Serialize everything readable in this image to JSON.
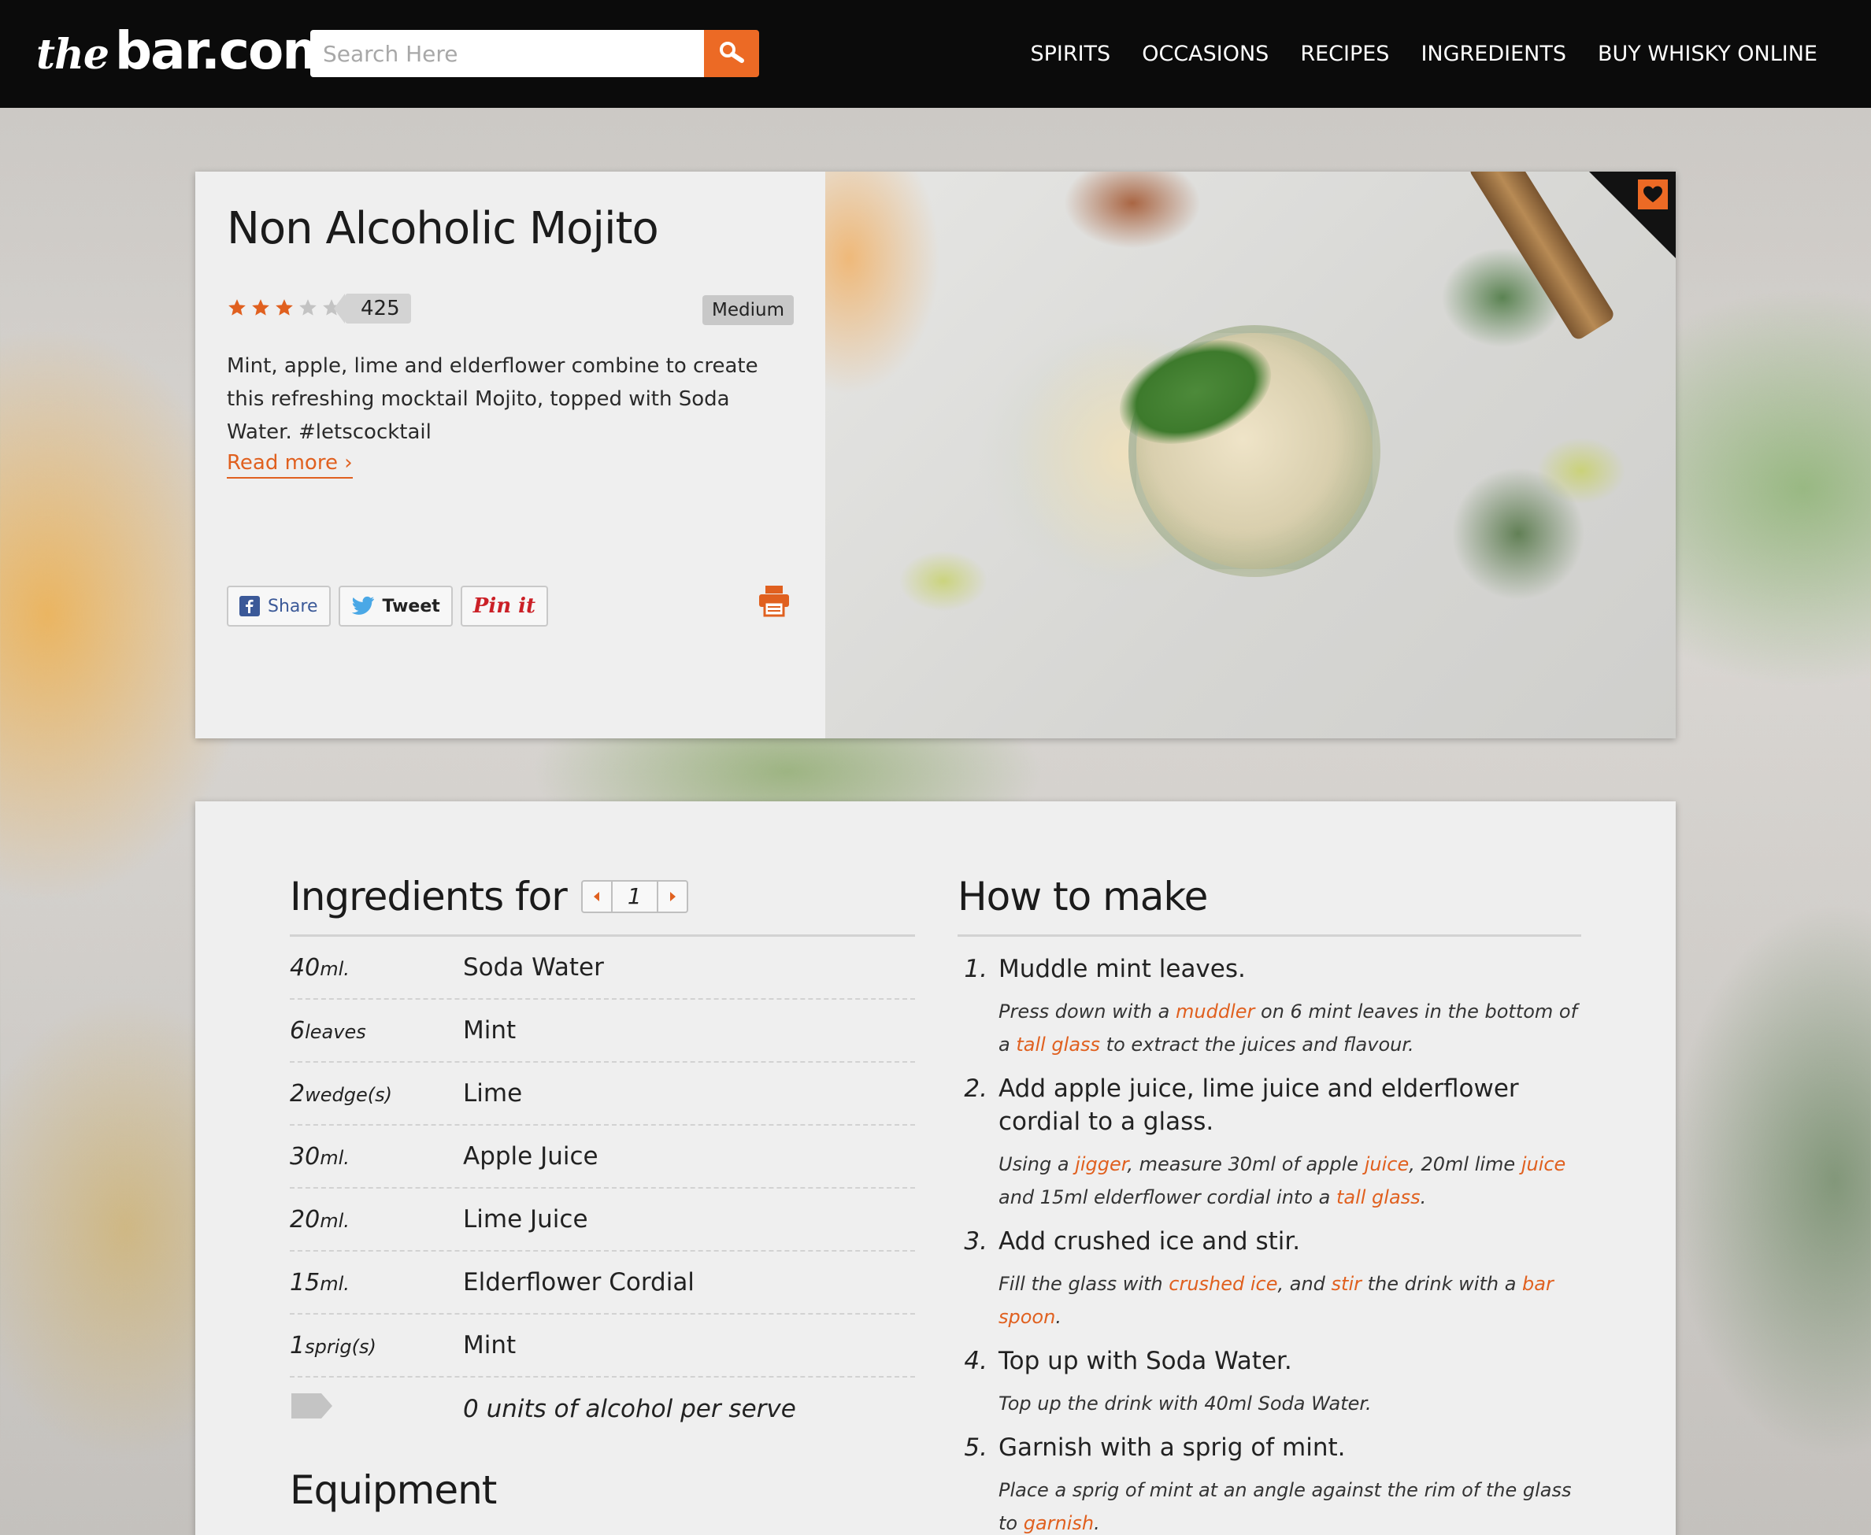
{
  "header": {
    "logo": {
      "the": "the",
      "bar": "bar.com",
      "reg": "®"
    },
    "search": {
      "placeholder": "Search Here",
      "button_icon": "search-icon"
    },
    "nav": [
      {
        "label": "SPIRITS"
      },
      {
        "label": "OCCASIONS"
      },
      {
        "label": "RECIPES"
      },
      {
        "label": "INGREDIENTS"
      },
      {
        "label": "BUY WHISKY ONLINE"
      }
    ]
  },
  "recipe": {
    "title": "Non Alcoholic Mojito",
    "rating": {
      "stars_filled": 3,
      "stars_total": 5,
      "count": "425"
    },
    "difficulty": "Medium",
    "description": "Mint, apple, lime and elderflower combine to create this refreshing mocktail Mojito, topped with Soda Water. #letscocktail",
    "read_more": "Read more ›",
    "share": {
      "facebook": "Share",
      "twitter": "Tweet",
      "pinterest": "Pin it"
    },
    "icons": {
      "print": "print-icon",
      "favourite": "heart-icon"
    },
    "accent_color": "#ec6a25"
  },
  "ingredients": {
    "heading": "Ingredients for",
    "serves": "1",
    "items": [
      {
        "qty": "40",
        "unit": "ml.",
        "name": "Soda Water"
      },
      {
        "qty": "6",
        "unit": "leaves",
        "name": "Mint"
      },
      {
        "qty": "2",
        "unit": "wedge(s)",
        "name": "Lime"
      },
      {
        "qty": "30",
        "unit": "ml.",
        "name": "Apple Juice"
      },
      {
        "qty": "20",
        "unit": "ml.",
        "name": "Lime Juice"
      },
      {
        "qty": "15",
        "unit": "ml.",
        "name": "Elderflower Cordial"
      },
      {
        "qty": "1",
        "unit": "sprig(s)",
        "name": "Mint"
      }
    ],
    "alcohol_units": "0 units of alcohol per serve"
  },
  "equipment": {
    "heading": "Equipment"
  },
  "how_to_make": {
    "heading": "How to make",
    "steps": [
      {
        "num": "1.",
        "title": "Muddle mint leaves.",
        "detail": [
          {
            "t": "Press down with a "
          },
          {
            "t": "muddler",
            "link": true
          },
          {
            "t": " on 6 mint leaves in the bottom of a "
          },
          {
            "t": "tall glass",
            "link": true
          },
          {
            "t": " to extract the juices and flavour."
          }
        ]
      },
      {
        "num": "2.",
        "title": "Add apple juice, lime juice and elderflower cordial to a glass.",
        "detail": [
          {
            "t": "Using a "
          },
          {
            "t": "jigger",
            "link": true
          },
          {
            "t": ", measure 30ml of apple "
          },
          {
            "t": "juice",
            "link": true
          },
          {
            "t": ", 20ml lime "
          },
          {
            "t": "juice",
            "link": true
          },
          {
            "t": " and 15ml elderflower cordial into a "
          },
          {
            "t": "tall glass",
            "link": true
          },
          {
            "t": "."
          }
        ]
      },
      {
        "num": "3.",
        "title": "Add crushed ice and stir.",
        "detail": [
          {
            "t": "Fill the glass with "
          },
          {
            "t": "crushed ice",
            "link": true
          },
          {
            "t": ", and "
          },
          {
            "t": "stir",
            "link": true
          },
          {
            "t": " the drink with a "
          },
          {
            "t": "bar spoon",
            "link": true
          },
          {
            "t": "."
          }
        ]
      },
      {
        "num": "4.",
        "title": "Top up with Soda Water.",
        "detail": [
          {
            "t": "Top up the drink with 40ml Soda Water."
          }
        ]
      },
      {
        "num": "5.",
        "title": "Garnish with a sprig of mint.",
        "detail": [
          {
            "t": "Place a sprig of mint at an angle against the rim of the glass to "
          },
          {
            "t": "garnish",
            "link": true
          },
          {
            "t": "."
          }
        ]
      }
    ]
  }
}
